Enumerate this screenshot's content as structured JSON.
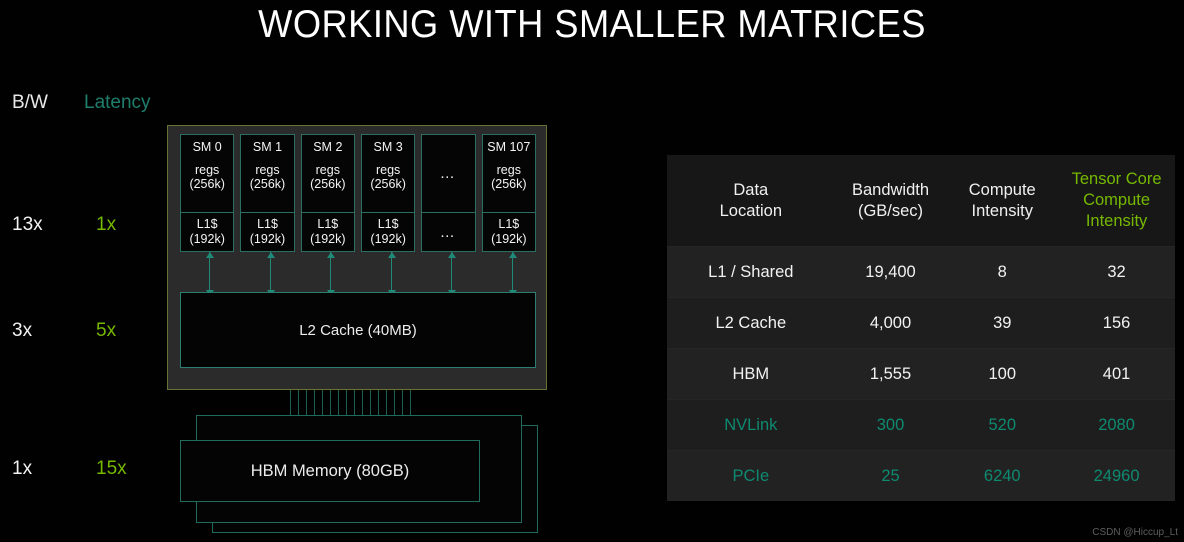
{
  "slide": {
    "title": "WORKING WITH SMALLER MATRICES",
    "watermark": "CSDN @Hiccup_Lt"
  },
  "legend": {
    "bandwidth_label": "B/W",
    "latency_label": "Latency",
    "latency_color": "#1e7f6d",
    "accent_green": "#76b900",
    "accent_teal": "#0e8a70"
  },
  "measures": [
    {
      "level": "l1",
      "bandwidth": "13x",
      "latency": "1x"
    },
    {
      "level": "l2",
      "bandwidth": "3x",
      "latency": "5x"
    },
    {
      "level": "hbm",
      "bandwidth": "1x",
      "latency": "15x"
    }
  ],
  "gpu": {
    "sms": [
      {
        "name": "SM 0",
        "regs_line1": "regs",
        "regs_line2": "(256k)",
        "cache_line1": "L1$",
        "cache_line2": "(192k)",
        "ellipsis": false
      },
      {
        "name": "SM 1",
        "regs_line1": "regs",
        "regs_line2": "(256k)",
        "cache_line1": "L1$",
        "cache_line2": "(192k)",
        "ellipsis": false
      },
      {
        "name": "SM 2",
        "regs_line1": "regs",
        "regs_line2": "(256k)",
        "cache_line1": "L1$",
        "cache_line2": "(192k)",
        "ellipsis": false
      },
      {
        "name": "SM 3",
        "regs_line1": "regs",
        "regs_line2": "(256k)",
        "cache_line1": "L1$",
        "cache_line2": "(192k)",
        "ellipsis": false
      },
      {
        "name": "",
        "regs_line1": "…",
        "regs_line2": "",
        "cache_line1": "…",
        "cache_line2": "",
        "ellipsis": true
      },
      {
        "name": "SM 107",
        "regs_line1": "regs",
        "regs_line2": "(256k)",
        "cache_line1": "L1$",
        "cache_line2": "(192k)",
        "ellipsis": false
      }
    ],
    "l2_label": "L2 Cache (40MB)",
    "hbm_label": "HBM Memory (80GB)"
  },
  "chart_data": {
    "type": "table",
    "title": "GPU memory hierarchy bandwidth and compute intensity",
    "columns": [
      {
        "line1": "Data",
        "line2": "Location",
        "line3": "",
        "color": "#f0f0f0"
      },
      {
        "line1": "Bandwidth",
        "line2": "(GB/sec)",
        "line3": "",
        "color": "#f0f0f0"
      },
      {
        "line1": "Compute",
        "line2": "Intensity",
        "line3": "",
        "color": "#f0f0f0"
      },
      {
        "line1": "Tensor Core",
        "line2": "Compute",
        "line3": "Intensity",
        "color": "#76b900"
      }
    ],
    "rows": [
      {
        "location": "L1 / Shared",
        "bandwidth": "19,400",
        "compute_intensity": "8",
        "tc_compute_intensity": "32",
        "highlight": false
      },
      {
        "location": "L2 Cache",
        "bandwidth": "4,000",
        "compute_intensity": "39",
        "tc_compute_intensity": "156",
        "highlight": false
      },
      {
        "location": "HBM",
        "bandwidth": "1,555",
        "compute_intensity": "100",
        "tc_compute_intensity": "401",
        "highlight": false
      },
      {
        "location": "NVLink",
        "bandwidth": "300",
        "compute_intensity": "520",
        "tc_compute_intensity": "2080",
        "highlight": true
      },
      {
        "location": "PCIe",
        "bandwidth": "25",
        "compute_intensity": "6240",
        "tc_compute_intensity": "24960",
        "highlight": true
      }
    ]
  }
}
